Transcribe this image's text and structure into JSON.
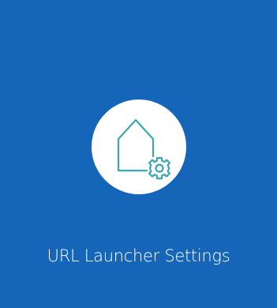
{
  "tile": {
    "label": "URL Launcher Settings",
    "icon": "home-settings-icon",
    "background_color": "#1566b8",
    "icon_color": "#3aa6b4"
  }
}
